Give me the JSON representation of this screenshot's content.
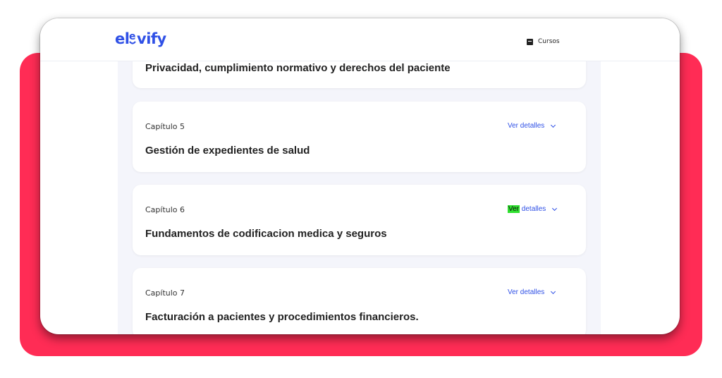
{
  "app": {
    "logo": "elevify",
    "brand_color": "#2f50e6",
    "accent_backdrop": "#ff2c55",
    "nav": {
      "courses_label": "Cursos",
      "courses_icon": "book-icon"
    }
  },
  "chapters": [
    {
      "chapter": "",
      "title": "Privacidad, cumplimiento normativo y derechos del paciente",
      "details_label": ""
    },
    {
      "chapter": "Capítulo 5",
      "title": "Gestión de expedientes de salud",
      "details_prefix": "Ver",
      "details_label": " detalles"
    },
    {
      "chapter": "Capítulo 6",
      "title": "Fundamentos de codificacion medica y seguros",
      "details_prefix": "Ver",
      "details_label": " detalles",
      "highlighted": true
    },
    {
      "chapter": "Capítulo 7",
      "title": "Facturación a pacientes y procedimientos financieros.",
      "details_prefix": "Ver",
      "details_label": " detalles"
    }
  ]
}
